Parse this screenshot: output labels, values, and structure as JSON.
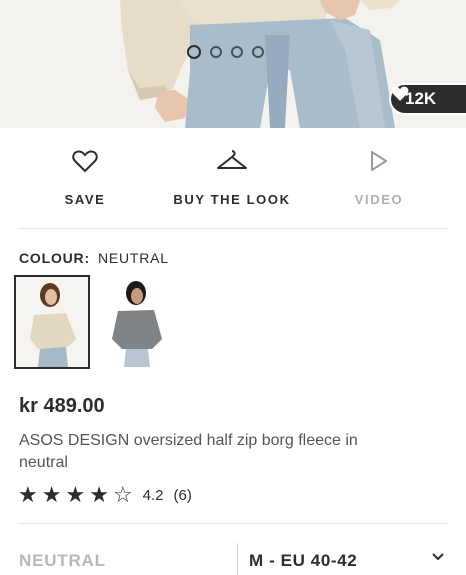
{
  "carousel": {
    "likes_count": "12K",
    "dots": 4,
    "active_dot": 0
  },
  "actions": {
    "save_label": "SAVE",
    "buy_the_look_label": "BUY THE LOOK",
    "video_label": "VIDEO"
  },
  "colour": {
    "key": "COLOUR:",
    "value": "NEUTRAL",
    "swatches": [
      "neutral",
      "grey"
    ]
  },
  "product": {
    "price": "kr 489.00",
    "title": "ASOS DESIGN oversized half zip borg fleece in neutral",
    "rating": {
      "value": "4.2",
      "count": "(6)",
      "stars_filled": 4,
      "stars_total": 5
    }
  },
  "selectors": {
    "colour_selected": "NEUTRAL",
    "size_selected": "M - EU 40-42"
  },
  "colors": {
    "text": "#2d2d2d",
    "muted": "#b0b0b0",
    "fleece": "#e4dac6",
    "denim": "#9fb4c6"
  },
  "icons": [
    "heart-icon",
    "hanger-icon",
    "play-icon",
    "star-icon",
    "chevron-down-icon"
  ]
}
